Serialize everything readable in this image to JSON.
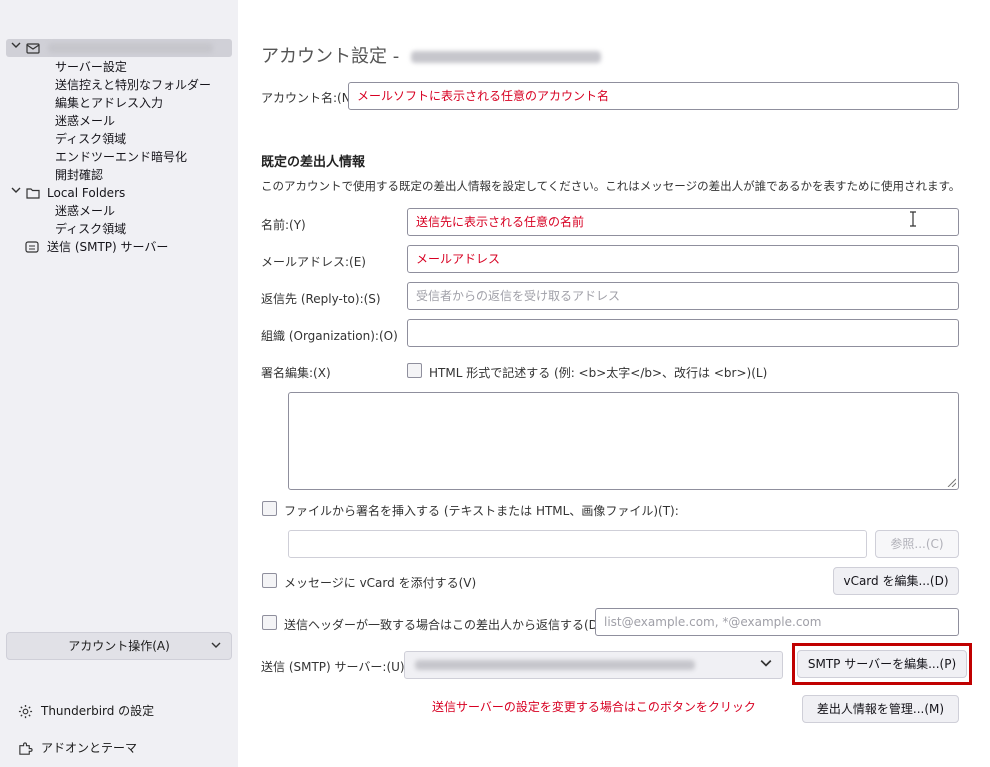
{
  "sidebar": {
    "tree": [
      {
        "label": "サーバー設定"
      },
      {
        "label": "送信控えと特別なフォルダー"
      },
      {
        "label": "編集とアドレス入力"
      },
      {
        "label": "迷惑メール"
      },
      {
        "label": "ディスク領域"
      },
      {
        "label": "エンドツーエンド暗号化"
      },
      {
        "label": "開封確認"
      }
    ],
    "local_folders": {
      "label": "Local Folders",
      "children": [
        {
          "label": "迷惑メール"
        },
        {
          "label": "ディスク領域"
        }
      ]
    },
    "smtp": {
      "label": "送信 (SMTP) サーバー"
    },
    "account_actions": "アカウント操作(A)",
    "settings_link": "Thunderbird の設定",
    "addons_link": "アドオンとテーマ"
  },
  "main": {
    "title_prefix": "アカウント設定 -",
    "account_name_label": "アカウント名:(N)",
    "account_name_value": "メールソフトに表示される任意のアカウント名",
    "identity_heading": "既定の差出人情報",
    "identity_desc": "このアカウントで使用する既定の差出人情報を設定してください。これはメッセージの差出人が誰であるかを表すために使用されます。",
    "name_label": "名前:(Y)",
    "name_value": "送信先に表示される任意の名前",
    "email_label": "メールアドレス:(E)",
    "email_value": "メールアドレス",
    "replyto_label": "返信先 (Reply-to):(S)",
    "replyto_placeholder": "受信者からの返信を受け取るアドレス",
    "org_label": "組織 (Organization):(O)",
    "sig_label": "署名編集:(X)",
    "html_sig_label": "HTML 形式で記述する (例: <b>太字</b>、改行は <br>)(L)",
    "file_sig_label": "ファイルから署名を挿入する (テキストまたは HTML、画像ファイル)(T):",
    "browse_button": "参照...(C)",
    "vcard_label": "メッセージに vCard を添付する(V)",
    "vcard_button": "vCard を編集...(D)",
    "reply_from_label": "送信ヘッダーが一致する場合はこの差出人から返信する(D):",
    "reply_from_placeholder": "list@example.com, *@example.com",
    "smtp_label": "送信 (SMTP) サーバー:(U)",
    "smtp_edit_button": "SMTP サーバーを編集...(P)",
    "note": "送信サーバーの設定を変更する場合はこのボタンをクリック",
    "manage_identities_button": "差出人情報を管理...(M)"
  },
  "colors": {
    "accent_red": "#d70022",
    "highlight_border": "#c00000",
    "sidebar_bg": "#f0f0f4"
  }
}
